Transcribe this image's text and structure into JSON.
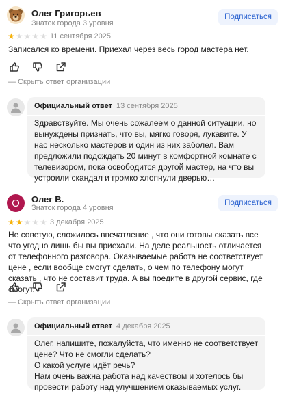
{
  "reviews": [
    {
      "author": "Олег Григорьев",
      "level": "Знаток города 3 уровня",
      "subscribe_label": "Подписаться",
      "rating": 1,
      "date": "11 сентября 2025",
      "text": "Записался ко времени. Приехал через весь город мастера нет.",
      "hide_reply_label": "— Скрыть ответ организации",
      "avatar_icon": "bear-avatar-icon",
      "reply": {
        "label": "Официальный ответ",
        "date": "13 сентября 2025",
        "text": "Здравствуйте. Мы очень сожалеем о данной ситуации, но вынуждены признать, что вы, мягко говоря, лукавите. У нас несколько мастеров и один из них заболел. Вам предложили подождать 20 минут в комфортной комнате с телевизором,  пока освободится другой мастер, на что вы устроили скандал и громко хлопнули дверью…"
      }
    },
    {
      "author": "Олег В.",
      "level": "Знаток города 4 уровня",
      "subscribe_label": "Подписаться",
      "avatar_letter": "О",
      "rating": 2,
      "date": "3 декабря 2025",
      "text": "Не советую, сложилось впечатление , что они готовы сказать все что угодно лишь бы вы приехали. На деле реальность отличается от телефонного разговора. Оказываемые работа не соответствует цене , если вообще смогут сделать, о чем по телефону могут сказать , что не составит труда. А вы поедите в другой сервис, где смогут.",
      "hide_reply_label": "— Скрыть ответ организации",
      "reply": {
        "label": "Официальный ответ",
        "date": "4 декабря 2025",
        "text": "Олег, напишите, пожалуйста, что именно не соответствует цене? Что не смогли сделать?\nО какой услуге идёт речь?\nНам очень важна работа над качеством  и хотелось бы провести работу над улучшением оказываемых услуг."
      }
    }
  ],
  "colors": {
    "star_on": "#f6b20a",
    "star_off": "#dcdcdc",
    "subscribe_bg": "#eef3fd",
    "subscribe_text": "#2a62d0",
    "avatar_o_bg": "#b0174e",
    "reply_bg": "#f3f3f3"
  }
}
